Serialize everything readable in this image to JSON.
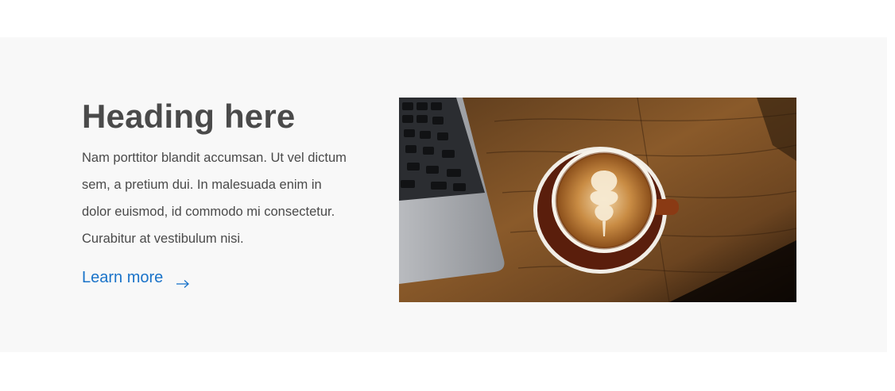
{
  "feature": {
    "heading": "Heading here",
    "body": "Nam porttitor blandit accumsan. Ut vel dictum sem, a pretium dui. In malesuada enim in dolor euismod, id commodo mi consectetur. Curabitur at vestibulum nisi.",
    "cta_label": "Learn more",
    "cta_icon": "arrow-right-icon",
    "image_subject": "coffee-latte-laptop-photo"
  },
  "colors": {
    "heading": "#4a4a4a",
    "body": "#4a4a4a",
    "link": "#1a73c9",
    "band": "#f8f8f8"
  }
}
